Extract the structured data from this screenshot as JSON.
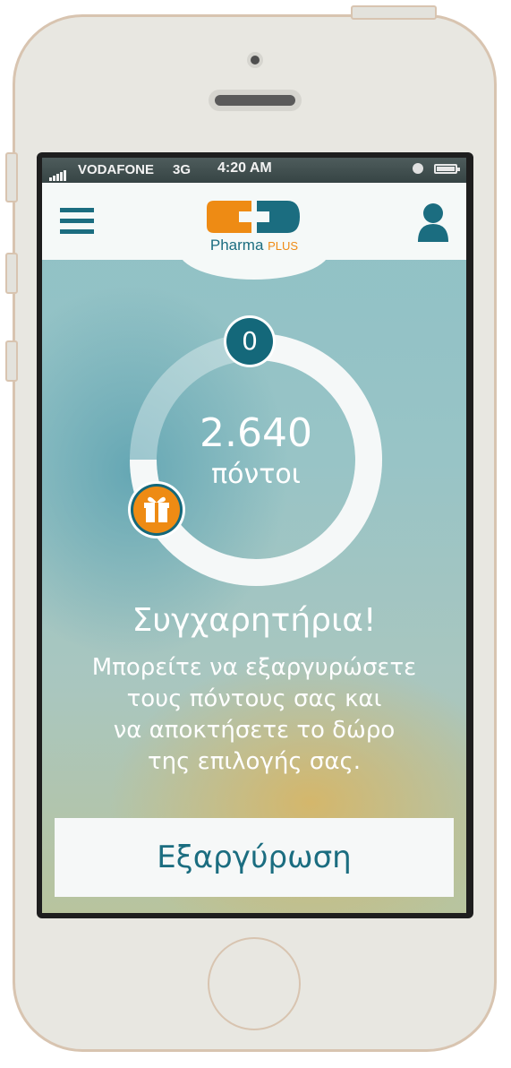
{
  "statusbar": {
    "carrier": "VODAFONE",
    "network": "3G",
    "time": "4:20 AM"
  },
  "header": {
    "logo_name": "Pharma",
    "logo_suffix": "PLUS",
    "menu_icon": "hamburger-menu-icon",
    "user_icon": "user-profile-icon"
  },
  "rewards": {
    "counter": "0",
    "points_value": "2.640",
    "points_label": "πόντοι",
    "gift_icon": "gift-icon"
  },
  "message": {
    "title": "Συγχαρητήρια!",
    "lines": [
      "Μπορείτε να εξαργυρώσετε",
      "τους πόντους σας και",
      "να αποκτήσετε το δώρο",
      "της επιλογής σας."
    ]
  },
  "actions": {
    "redeem_label": "Εξαργύρωση"
  },
  "colors": {
    "brand_teal": "#1b6d80",
    "brand_orange": "#ee8b14",
    "device_frame": "#e8e7e1"
  }
}
